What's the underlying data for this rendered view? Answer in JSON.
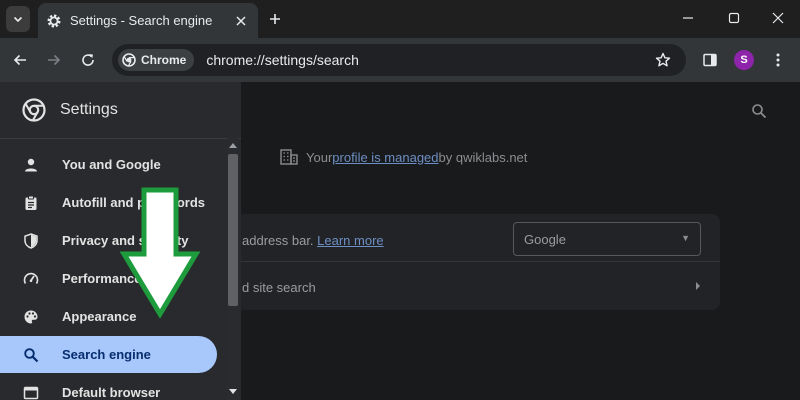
{
  "browser": {
    "tab_title": "Settings - Search engine",
    "new_tab_symbol": "+",
    "omnibox": {
      "chip_label": "Chrome",
      "url": "chrome://settings/search"
    },
    "profile_initial": "S",
    "profile_color": "#8e24aa"
  },
  "drawer": {
    "title": "Settings",
    "items": [
      {
        "label": "You and Google",
        "icon": "person-icon"
      },
      {
        "label": "Autofill and passwords",
        "icon": "clipboard-icon"
      },
      {
        "label": "Privacy and security",
        "icon": "shield-icon"
      },
      {
        "label": "Performance",
        "icon": "speedometer-icon"
      },
      {
        "label": "Appearance",
        "icon": "palette-icon"
      },
      {
        "label": "Search engine",
        "icon": "search-icon",
        "active": true
      },
      {
        "label": "Default browser",
        "icon": "browser-window-icon"
      }
    ],
    "active_color": "#a8c7fa"
  },
  "main": {
    "managed_prefix": "Your ",
    "managed_link": "profile is managed",
    "managed_suffix": " by qwiklabs.net",
    "row1_text": "address bar. ",
    "row1_link": "Learn more",
    "search_engine_value": "Google",
    "row2_text": "d site search"
  },
  "annotation": {
    "arrow_color": "#1e9b3c"
  }
}
